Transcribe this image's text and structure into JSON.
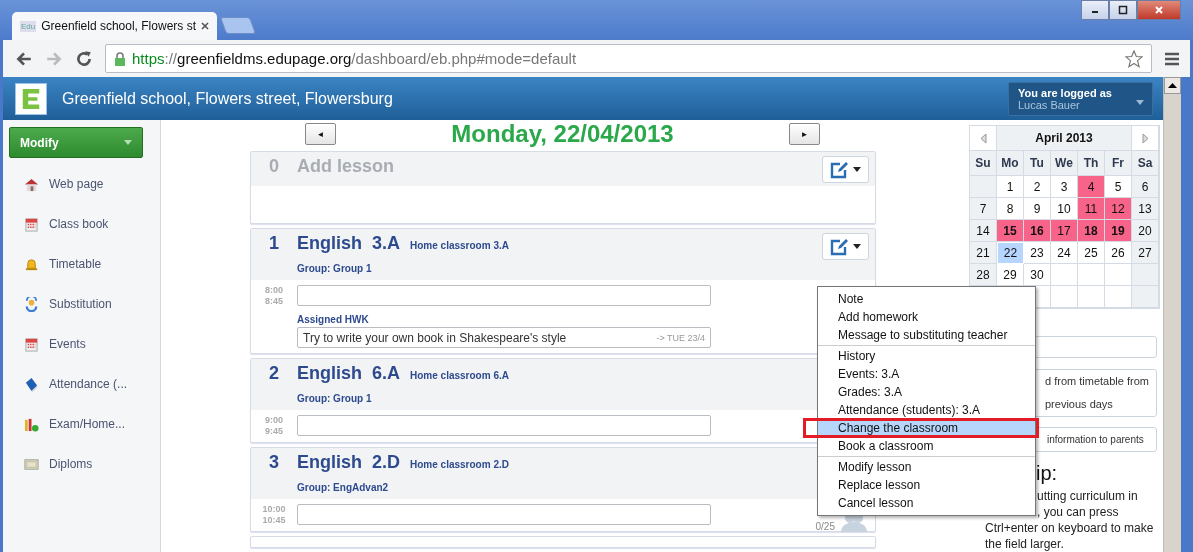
{
  "browser": {
    "tab_title": "Greenfield school, Flowers st",
    "tab_favicon": "Edu",
    "url_scheme": "https",
    "url_sep": "://",
    "url_host": "greenfieldms.edupage.org",
    "url_path": "/dashboard/eb.php#mode=default"
  },
  "header": {
    "title": "Greenfield school, Flowers street, Flowersburg",
    "login_label": "You are logged as",
    "user": "Lucas Bauer"
  },
  "sidebar": {
    "button": "Modify",
    "items": [
      {
        "label": "Web page"
      },
      {
        "label": "Class book"
      },
      {
        "label": "Timetable"
      },
      {
        "label": "Substitution"
      },
      {
        "label": "Events"
      },
      {
        "label": "Attendance (..."
      },
      {
        "label": "Exam/Home..."
      },
      {
        "label": "Diploms"
      }
    ]
  },
  "day_nav": {
    "prev": "◄",
    "title": "Monday, 22/04/2013",
    "next": "►"
  },
  "lessons": [
    {
      "number": "0",
      "kind": "empty",
      "edit": true,
      "title": "Add lesson"
    },
    {
      "number": "1",
      "kind": "lesson",
      "edit": true,
      "subject": "English",
      "class": "3.A",
      "room": "Home classroom 3.A",
      "group": "Group: Group 1",
      "start": "8:00",
      "end": "8:45",
      "hw_label": "Assigned HWK",
      "hw_value": "Try to write your own book in Shakespeare's style",
      "hw_due": "-> TUE 23/4"
    },
    {
      "number": "2",
      "kind": "lesson",
      "edit": false,
      "subject": "English",
      "class": "6.A",
      "room": "Home classroom 6.A",
      "group": "Group: Group 1",
      "start": "9:00",
      "end": "9:45"
    },
    {
      "number": "3",
      "kind": "lesson",
      "edit": false,
      "subject": "English",
      "class": "2.D",
      "room": "Home classroom 2.D",
      "group": "Group: EngAdvan2",
      "start": "10:00",
      "end": "10:45",
      "count": "0/25"
    }
  ],
  "menu": {
    "groups": [
      [
        {
          "label": "Note",
          "selected": false
        },
        {
          "label": "Add homework",
          "selected": false
        },
        {
          "label": "Message to substituting teacher",
          "selected": false
        }
      ],
      [
        {
          "label": "History",
          "selected": false
        },
        {
          "label": "Events: 3.A",
          "selected": false
        },
        {
          "label": "Grades: 3.A",
          "selected": false
        },
        {
          "label": "Attendance (students): 3.A",
          "selected": false
        },
        {
          "label": "Change the classroom",
          "selected": true
        },
        {
          "label": "Book a classroom",
          "selected": false
        }
      ],
      [
        {
          "label": "Modify lesson",
          "selected": false
        },
        {
          "label": "Replace lesson",
          "selected": false
        },
        {
          "label": "Cancel lesson",
          "selected": false
        }
      ]
    ]
  },
  "calendar": {
    "month": "April 2013",
    "weekdays": [
      "Su",
      "Mo",
      "Tu",
      "We",
      "Th",
      "Fr",
      "Sa"
    ],
    "weeks": [
      [
        {
          "day": "1",
          "marked": false,
          "bold": false,
          "selected": false
        },
        {
          "day": "2",
          "marked": false,
          "bold": false,
          "selected": false
        },
        {
          "day": "3",
          "marked": false,
          "bold": false,
          "selected": false
        },
        {
          "day": "4",
          "marked": true,
          "bold": false,
          "selected": false
        },
        {
          "day": "5",
          "marked": false,
          "bold": false,
          "selected": false
        },
        {
          "day": "6",
          "marked": false,
          "bold": false,
          "selected": false
        }
      ],
      [
        {
          "day": "7",
          "marked": false,
          "bold": false,
          "selected": false
        },
        {
          "day": "8",
          "marked": false,
          "bold": false,
          "selected": false
        },
        {
          "day": "9",
          "marked": false,
          "bold": false,
          "selected": false
        },
        {
          "day": "10",
          "marked": false,
          "bold": false,
          "selected": false
        },
        {
          "day": "11",
          "marked": true,
          "bold": false,
          "selected": false
        },
        {
          "day": "12",
          "marked": true,
          "bold": false,
          "selected": false
        },
        {
          "day": "13",
          "marked": false,
          "bold": false,
          "selected": false
        }
      ],
      [
        {
          "day": "14",
          "marked": false,
          "bold": false,
          "selected": false
        },
        {
          "day": "15",
          "marked": true,
          "bold": true,
          "selected": false
        },
        {
          "day": "16",
          "marked": true,
          "bold": true,
          "selected": false
        },
        {
          "day": "17",
          "marked": true,
          "bold": false,
          "selected": false
        },
        {
          "day": "18",
          "marked": true,
          "bold": true,
          "selected": false
        },
        {
          "day": "19",
          "marked": true,
          "bold": true,
          "selected": false
        },
        {
          "day": "20",
          "marked": false,
          "bold": false,
          "selected": false
        }
      ],
      [
        {
          "day": "21",
          "marked": false,
          "bold": false,
          "selected": false
        },
        {
          "day": "22",
          "marked": false,
          "bold": false,
          "selected": true
        },
        {
          "day": "23",
          "marked": false,
          "bold": false,
          "selected": false
        },
        {
          "day": "24",
          "marked": false,
          "bold": false,
          "selected": false
        },
        {
          "day": "25",
          "marked": false,
          "bold": false,
          "selected": false
        },
        {
          "day": "26",
          "marked": false,
          "bold": false,
          "selected": false
        },
        {
          "day": "27",
          "marked": false,
          "bold": false,
          "selected": false
        }
      ],
      [
        {
          "day": "28",
          "marked": false,
          "bold": false,
          "selected": false
        },
        {
          "day": "29",
          "marked": false,
          "bold": false,
          "selected": false
        },
        {
          "day": "30",
          "marked": false,
          "bold": false,
          "selected": false
        }
      ]
    ]
  },
  "side_buttons": [
    {
      "lines": [
        "d from timetable from",
        "previous days"
      ]
    },
    {
      "lines": [
        "information to parents"
      ]
    }
  ],
  "tip": {
    "heading": "ip:",
    "lines": [
      {
        "text": "utting curriculum in",
        "kind": "partial"
      },
      {
        "text": ", you can press",
        "kind": "partial"
      },
      {
        "text": "Ctrl+enter on keyboard to make",
        "kind": "full"
      },
      {
        "text": "the field larger.",
        "kind": "full"
      }
    ]
  }
}
